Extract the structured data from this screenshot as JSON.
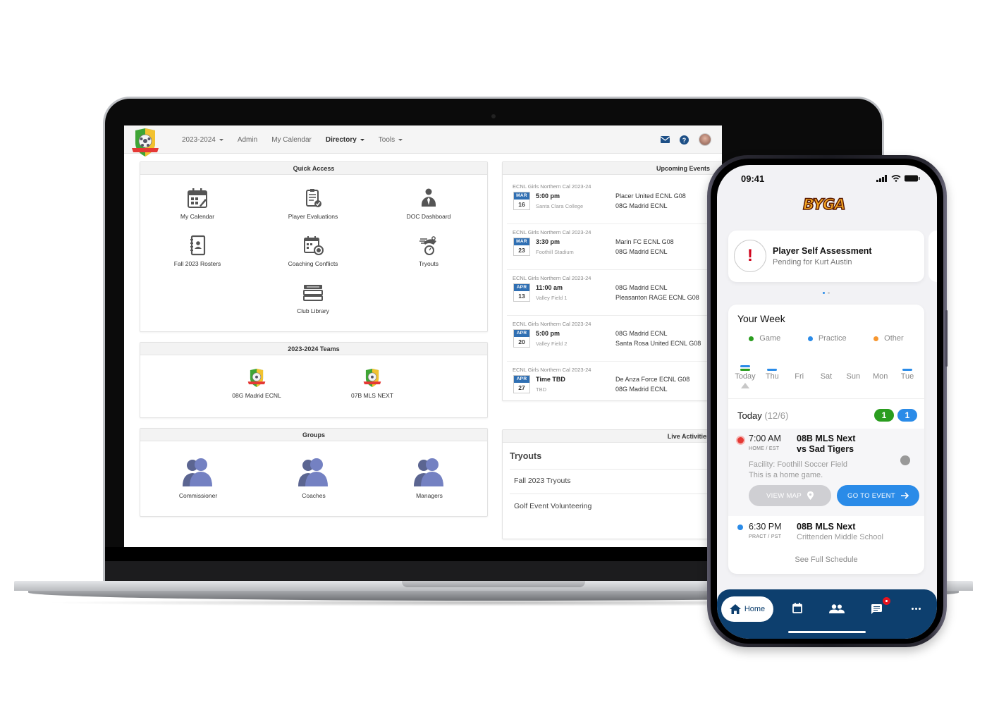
{
  "desktop": {
    "nav": {
      "season": "2023-2024",
      "items": [
        "Admin",
        "My Calendar",
        "Directory",
        "Tools"
      ]
    },
    "quick_access": {
      "title": "Quick Access",
      "items": [
        {
          "label": "My Calendar",
          "icon": "calendar-icon"
        },
        {
          "label": "Player Evaluations",
          "icon": "clipboard-check-icon"
        },
        {
          "label": "DOC Dashboard",
          "icon": "person-tie-icon"
        },
        {
          "label": "Fall 2023 Rosters",
          "icon": "address-book-icon"
        },
        {
          "label": "Coaching Conflicts",
          "icon": "calendar-clock-icon"
        },
        {
          "label": "Tryouts",
          "icon": "tryouts-stopwatch-icon"
        },
        {
          "label": "Club Library",
          "icon": "books-icon"
        }
      ]
    },
    "teams": {
      "title": "2023-2024 Teams",
      "items": [
        "08G Madrid ECNL",
        "07B MLS NEXT"
      ]
    },
    "groups": {
      "title": "Groups",
      "items": [
        "Commissioner",
        "Coaches",
        "Managers"
      ]
    },
    "upcoming_events": {
      "title": "Upcoming Events",
      "items": [
        {
          "league": "ECNL Girls Northern Cal 2023-24",
          "month": "MAR",
          "day": "16",
          "time": "5:00 pm",
          "location": "Santa Clara College",
          "team1": "Placer United ECNL G08",
          "team2": "08G Madrid ECNL"
        },
        {
          "league": "ECNL Girls Northern Cal 2023-24",
          "month": "MAR",
          "day": "23",
          "time": "3:30 pm",
          "location": "Foothill Stadium",
          "team1": "Marin FC ECNL G08",
          "team2": "08G Madrid ECNL"
        },
        {
          "league": "ECNL Girls Northern Cal 2023-24",
          "month": "APR",
          "day": "13",
          "time": "11:00 am",
          "location": "Valley Field 1",
          "team1": "08G Madrid ECNL",
          "team2": "Pleasanton RAGE ECNL G08"
        },
        {
          "league": "ECNL Girls Northern Cal 2023-24",
          "month": "APR",
          "day": "20",
          "time": "5:00 pm",
          "location": "Valley Field 2",
          "team1": "08G Madrid ECNL",
          "team2": "Santa Rosa United ECNL G08"
        },
        {
          "league": "ECNL Girls Northern Cal 2023-24",
          "month": "APR",
          "day": "27",
          "time": "Time TBD",
          "location": "TBD",
          "team1": "De Anza Force ECNL G08",
          "team2": "08G Madrid ECNL"
        }
      ]
    },
    "live_activities": {
      "title": "Live Activities",
      "section": "Tryouts",
      "items": [
        "Fall 2023 Tryouts",
        "Golf Event Volunteering"
      ]
    }
  },
  "phone": {
    "status_time": "09:41",
    "brand": "BYGA",
    "alert": {
      "title": "Player Self Assessment",
      "subtitle": "Pending for Kurt Austin",
      "icon": "!"
    },
    "week": {
      "title": "Your Week",
      "legend": [
        {
          "label": "Game",
          "color": "#2a9d1f"
        },
        {
          "label": "Practice",
          "color": "#2a8be8"
        },
        {
          "label": "Other",
          "color": "#f7962f"
        }
      ],
      "days": [
        {
          "label": "Today",
          "bars": [
            "#2a8be8",
            "#2a9d1f"
          ],
          "selected": true
        },
        {
          "label": "Thu",
          "bars": [
            "#2a8be8"
          ]
        },
        {
          "label": "Fri",
          "bars": []
        },
        {
          "label": "Sat",
          "bars": []
        },
        {
          "label": "Sun",
          "bars": []
        },
        {
          "label": "Mon",
          "bars": []
        },
        {
          "label": "Tue",
          "bars": [
            "#2a8be8"
          ]
        }
      ]
    },
    "today": {
      "label": "Today",
      "date": "(12/6)",
      "game_count": "1",
      "practice_count": "1",
      "events": [
        {
          "time": "7:00 AM",
          "kind": "HOME / EST",
          "title_line1": "08B MLS Next",
          "title_line2": "vs Sad Tigers",
          "facility": "Facility: Foothill Soccer Field",
          "note": "This is a home game.",
          "view_map": "VIEW MAP",
          "go_to_event": "GO TO EVENT"
        },
        {
          "time": "6:30 PM",
          "kind": "PRACT / PST",
          "title": "08B MLS Next",
          "location": "Crittenden Middle School"
        }
      ],
      "see_full": "See Full Schedule"
    },
    "tabbar": {
      "home": "Home"
    }
  },
  "colors": {
    "accent_blue": "#2a8be8",
    "nav_navy": "#0d3f6e",
    "game_green": "#2a9d1f",
    "alert_red": "#d0021b"
  }
}
